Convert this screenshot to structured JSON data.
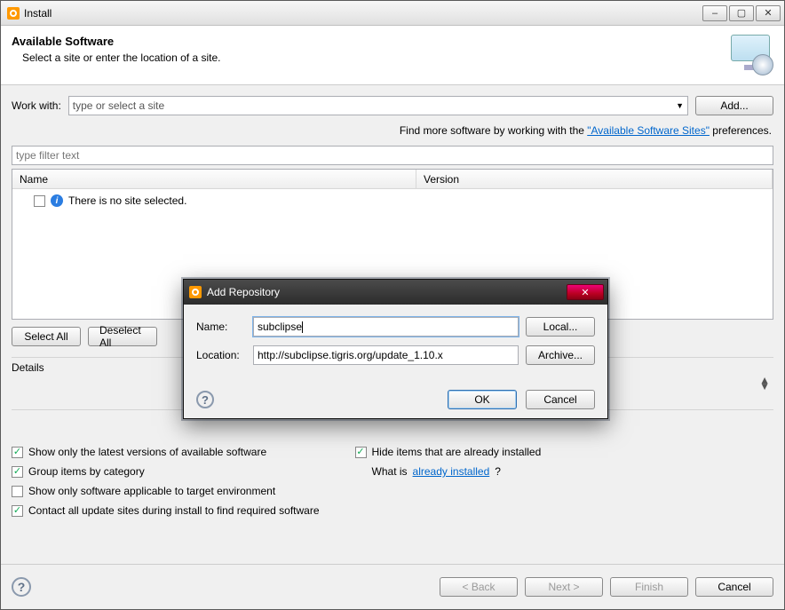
{
  "window": {
    "title": "Install",
    "minimize": "–",
    "maximize": "▢",
    "close": "✕"
  },
  "header": {
    "title": "Available Software",
    "subtitle": "Select a site or enter the location of a site."
  },
  "workwith": {
    "label": "Work with:",
    "placeholder": "type or select a site",
    "add_btn": "Add..."
  },
  "hint": {
    "prefix": "Find more software by working with the ",
    "link": "\"Available Software Sites\"",
    "suffix": " preferences."
  },
  "filter": {
    "placeholder": "type filter text"
  },
  "tree": {
    "col_name": "Name",
    "col_version": "Version",
    "empty_msg": "There is no site selected."
  },
  "buttons": {
    "select_all": "Select All",
    "deselect_all": "Deselect All",
    "back": "< Back",
    "next": "Next >",
    "finish": "Finish",
    "cancel": "Cancel"
  },
  "details_label": "Details",
  "options": {
    "latest": "Show only the latest versions of available software",
    "group": "Group items by category",
    "target": "Show only software applicable to target environment",
    "contact": "Contact all update sites during install to find required software",
    "hide_installed": "Hide items that are already installed",
    "whatis_prefix": "What is ",
    "whatis_link": "already installed",
    "whatis_suffix": "?"
  },
  "dialog": {
    "title": "Add Repository",
    "name_lbl": "Name:",
    "name_val": "subclipse",
    "loc_lbl": "Location:",
    "loc_val": "http://subclipse.tigris.org/update_1.10.x",
    "local_btn": "Local...",
    "archive_btn": "Archive...",
    "ok": "OK",
    "cancel": "Cancel"
  }
}
